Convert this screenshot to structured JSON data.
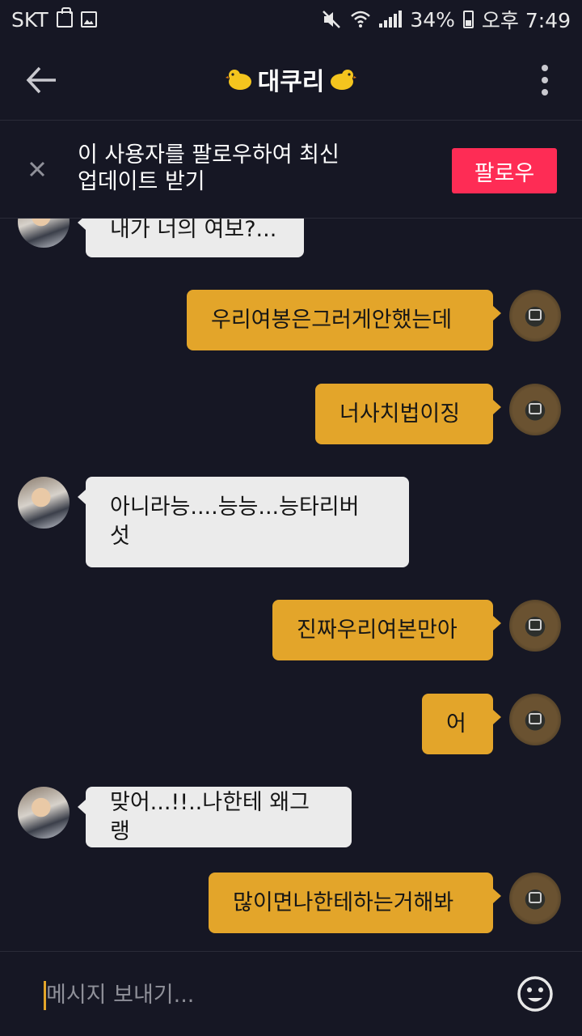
{
  "status": {
    "carrier": "SKT",
    "battery": "34%",
    "time": "오후 7:49"
  },
  "header": {
    "title": "대쿠리"
  },
  "follow_banner": {
    "line1": "이 사용자를 팔로우하여 최신",
    "line2": "업데이트 받기",
    "button": "팔로우"
  },
  "messages": [
    {
      "from": "other",
      "text": "내가 너의 여보?..."
    },
    {
      "from": "me",
      "text": "우리여봉은그러게안했는데"
    },
    {
      "from": "me",
      "text": "너사치법이징"
    },
    {
      "from": "other",
      "line1": "아니라능....능능...능타리버",
      "line2": "섯"
    },
    {
      "from": "me",
      "text": "진짜우리여본만아"
    },
    {
      "from": "me",
      "text": "어"
    },
    {
      "from": "other",
      "text": "맞어...!!..나한테 왜그랭"
    },
    {
      "from": "me",
      "text": "많이면나한테하는거해봐"
    }
  ],
  "composer": {
    "placeholder": "메시지 보내기..."
  },
  "colors": {
    "background": "#161724",
    "my_bubble": "#e3a52a",
    "other_bubble": "#ebebeb",
    "follow_button": "#fe2c55"
  },
  "icons": [
    "back-arrow-icon",
    "more-vertical-icon",
    "chick-emoji-icon",
    "close-icon",
    "emoji-face-icon",
    "mute-icon",
    "wifi-icon",
    "signal-icon",
    "battery-icon"
  ]
}
